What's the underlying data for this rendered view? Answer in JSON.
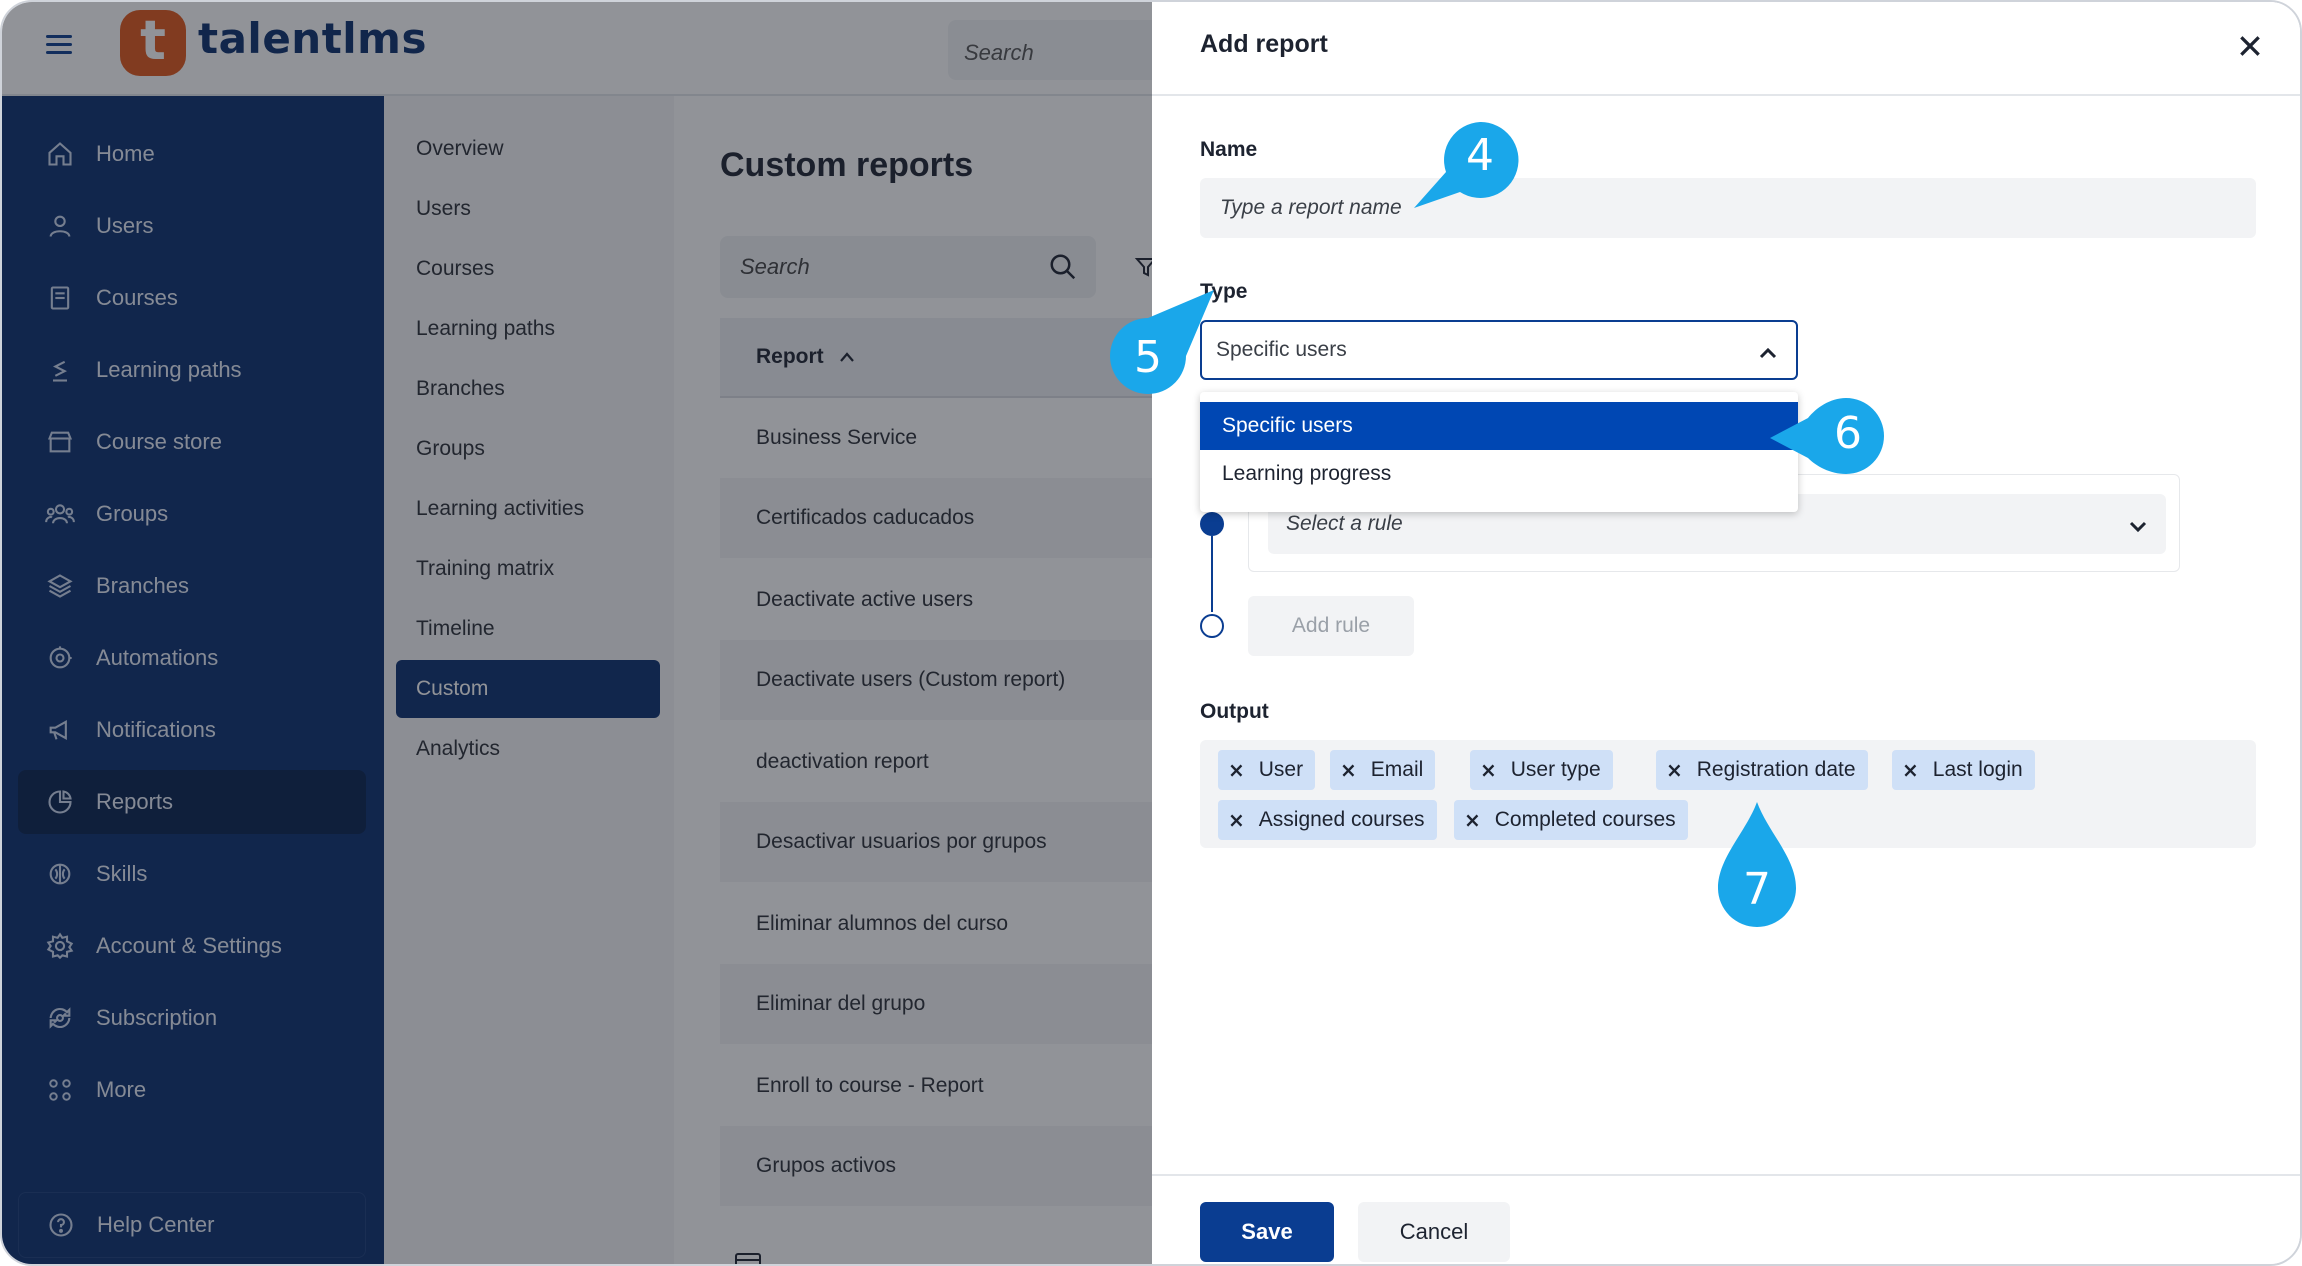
{
  "app": {
    "brand_letter": "t",
    "brand_name": "talentlms",
    "search_placeholder": "Search"
  },
  "sidebar": {
    "items": [
      {
        "label": "Home",
        "icon": "home-icon"
      },
      {
        "label": "Users",
        "icon": "user-icon"
      },
      {
        "label": "Courses",
        "icon": "book-icon"
      },
      {
        "label": "Learning paths",
        "icon": "path-icon"
      },
      {
        "label": "Course store",
        "icon": "store-icon"
      },
      {
        "label": "Groups",
        "icon": "group-icon"
      },
      {
        "label": "Branches",
        "icon": "layers-icon"
      },
      {
        "label": "Automations",
        "icon": "automation-icon"
      },
      {
        "label": "Notifications",
        "icon": "megaphone-icon"
      },
      {
        "label": "Reports",
        "icon": "pie-chart-icon"
      },
      {
        "label": "Skills",
        "icon": "brain-icon"
      },
      {
        "label": "Account & Settings",
        "icon": "gear-icon"
      },
      {
        "label": "Subscription",
        "icon": "subscription-icon"
      },
      {
        "label": "More",
        "icon": "grid-icon"
      }
    ],
    "active": "Reports",
    "help_label": "Help Center"
  },
  "submenu": {
    "items": [
      "Overview",
      "Users",
      "Courses",
      "Learning paths",
      "Branches",
      "Groups",
      "Learning activities",
      "Training matrix",
      "Timeline",
      "Custom",
      "Analytics"
    ],
    "active": "Custom"
  },
  "main": {
    "title": "Custom reports",
    "search_placeholder": "Search",
    "column_header": "Report",
    "rows": [
      "Business Service",
      "Certificados caducados",
      "Deactivate active users",
      "Deactivate users (Custom report)",
      "deactivation report",
      "Desactivar usuarios por grupos",
      "Eliminar alumnos del curso",
      "Eliminar del grupo",
      "Enroll to course - Report",
      "Grupos activos"
    ]
  },
  "drawer": {
    "title": "Add report",
    "name_label": "Name",
    "name_placeholder": "Type a report name",
    "type_label": "Type",
    "type_selected": "Specific users",
    "type_options": [
      "Specific users",
      "Learning progress"
    ],
    "rule_placeholder": "Select a rule",
    "add_rule_label": "Add rule",
    "output_label": "Output",
    "output_tags": [
      "User",
      "Email",
      "User type",
      "Registration date",
      "Last login",
      "Assigned courses",
      "Completed courses"
    ],
    "save_label": "Save",
    "cancel_label": "Cancel"
  },
  "callouts": [
    "4",
    "5",
    "6",
    "7"
  ],
  "colors": {
    "brand_navy": "#0a2e6d",
    "brand_orange": "#e0571a",
    "primary_button": "#0a3d91",
    "selected_option": "#0047b3",
    "tag_bg": "#cfe0f7",
    "callout": "#1aa7ea"
  }
}
